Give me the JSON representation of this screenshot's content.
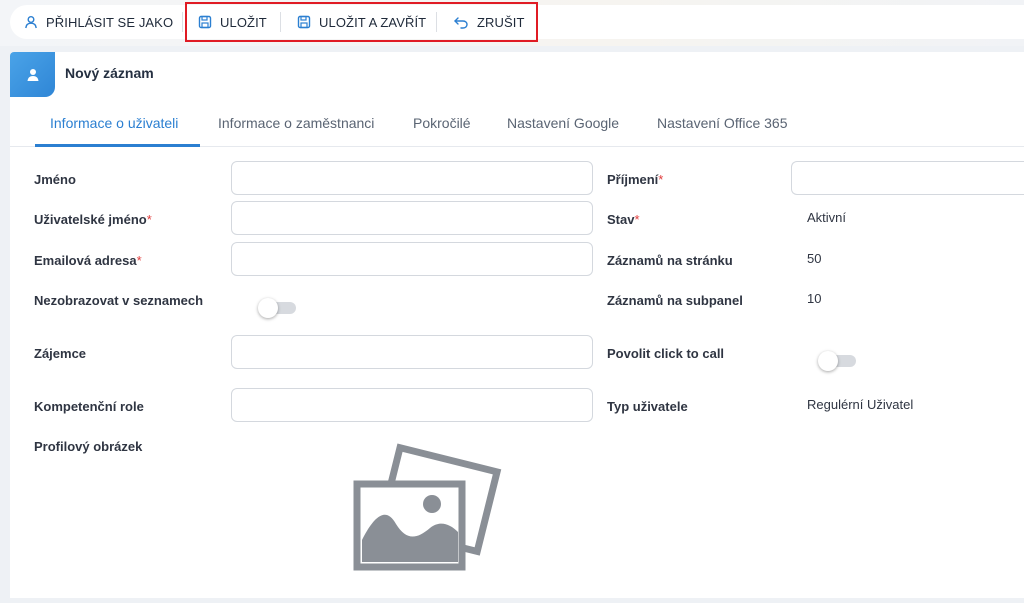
{
  "toolbar": {
    "login_as_label": "PŘIHLÁSIT SE JAKO",
    "save_label": "ULOŽIT",
    "save_close_label": "ULOŽIT A ZAVŘÍT",
    "cancel_label": "ZRUŠIT",
    "icons": {
      "login_as": "user-icon",
      "save": "floppy-disk-icon",
      "save_close": "floppy-disk-icon",
      "cancel": "undo-arrow-icon"
    },
    "accent_color": "#2b7fd1",
    "highlight_color": "#e01b24"
  },
  "record": {
    "title": "Nový záznam",
    "icon": "user-icon"
  },
  "tabs": [
    {
      "label": "Informace o uživateli",
      "active": true
    },
    {
      "label": "Informace o zaměstnanci",
      "active": false
    },
    {
      "label": "Pokročilé",
      "active": false
    },
    {
      "label": "Nastavení Google",
      "active": false
    },
    {
      "label": "Nastavení Office 365",
      "active": false
    }
  ],
  "form": {
    "left": {
      "first_name": {
        "label": "Jméno",
        "value": ""
      },
      "username": {
        "label": "Uživatelské jméno",
        "required_mark": "*",
        "value": ""
      },
      "email": {
        "label": "Emailová adresa",
        "required_mark": "*",
        "value": ""
      },
      "hide_in_lists": {
        "label": "Nezobrazovat v seznamech",
        "checked": false
      },
      "lead": {
        "label": "Zájemce",
        "value": ""
      },
      "competence_role": {
        "label": "Kompetenční role",
        "value": ""
      },
      "profile_picture": {
        "label": "Profilový obrázek",
        "icon": "image-placeholder-icon"
      }
    },
    "right": {
      "last_name": {
        "label": "Příjmení",
        "required_mark": "*",
        "value": ""
      },
      "status": {
        "label": "Stav",
        "required_mark": "*",
        "value": "Aktivní"
      },
      "records_per_page": {
        "label": "Záznamů na stránku",
        "value": "50"
      },
      "records_per_subpanel": {
        "label": "Záznamů na subpanel",
        "value": "10"
      },
      "click_to_call": {
        "label": "Povolit click to call",
        "checked": false
      },
      "user_type": {
        "label": "Typ uživatele",
        "value": "Regulérní Uživatel"
      }
    }
  }
}
